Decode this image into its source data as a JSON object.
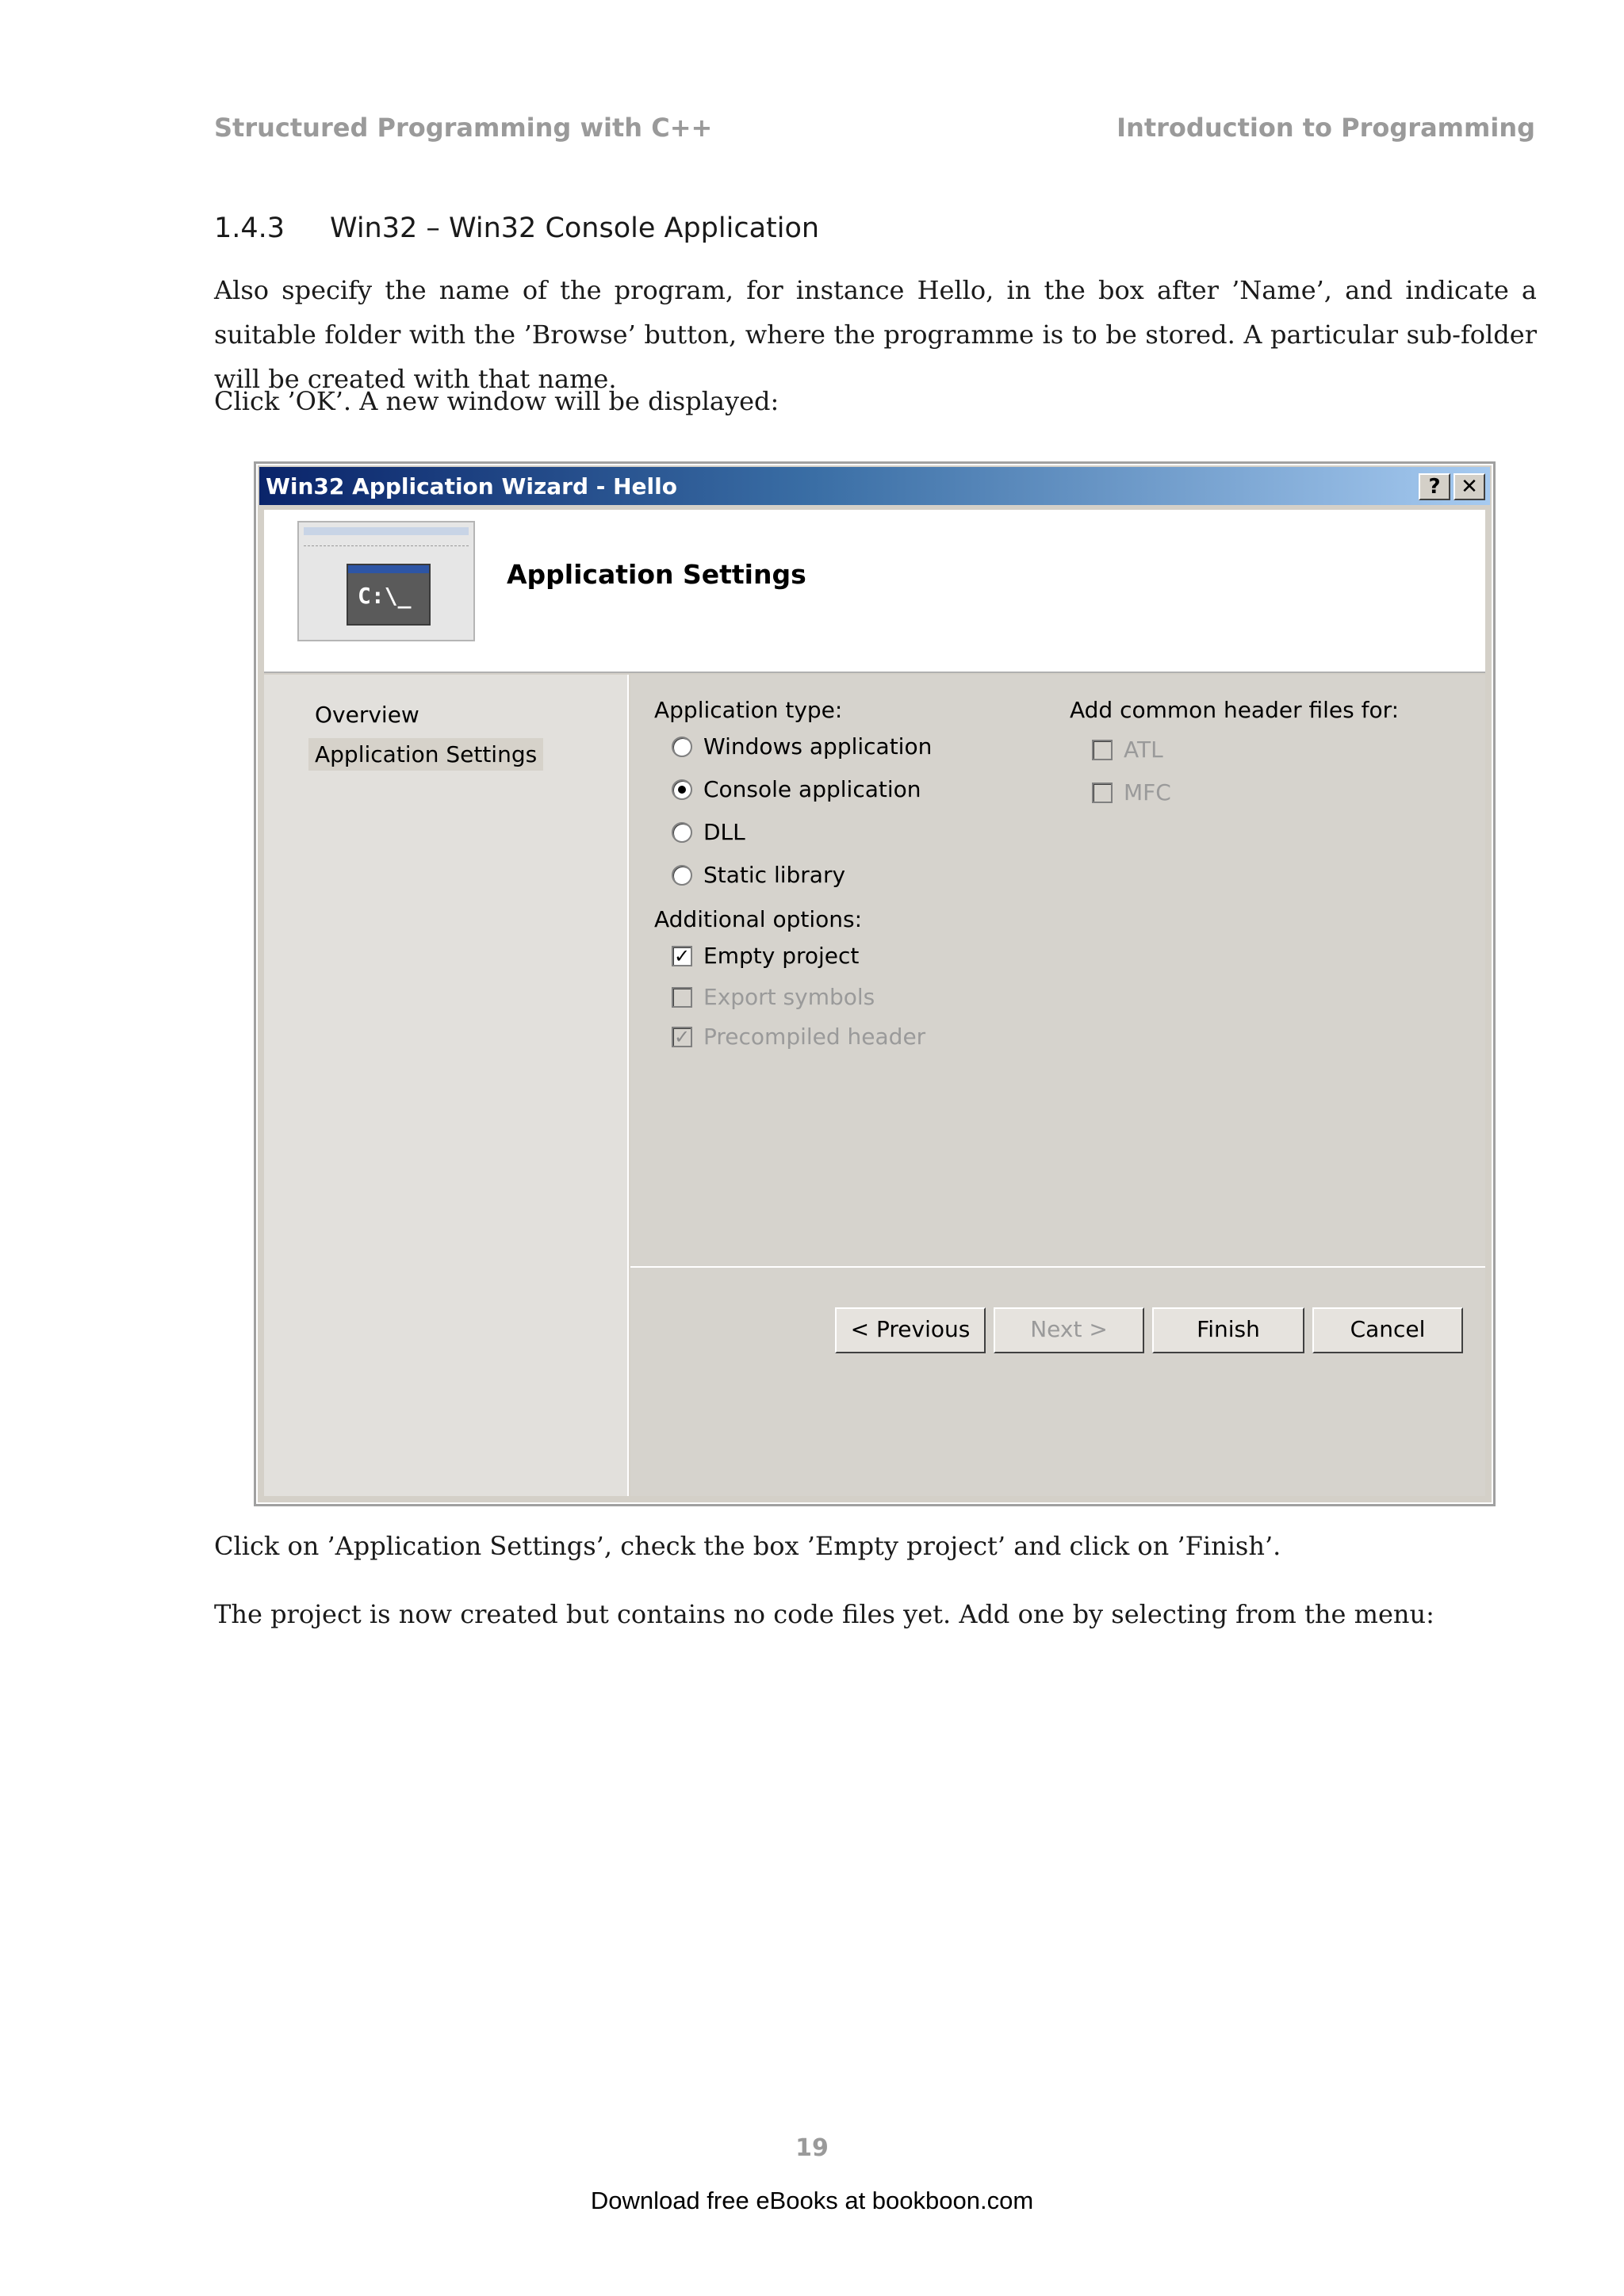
{
  "running_head": {
    "left": "Structured Programming with C++",
    "right": "Introduction to Programming"
  },
  "section": {
    "number": "1.4.3",
    "title": "Win32 – Win32 Console Application"
  },
  "paragraphs": {
    "p1": "Also specify the name of the program, for instance Hello, in the box after ’Name’, and indicate a suitable folder with the ’Browse’ button, where the programme is to be stored. A particular sub-folder will be created with that name.",
    "p2": "Click ’OK’. A new window will be displayed:",
    "p3": "Click on ’Application Settings’, check the box ’Empty project’ and click on ’Finish’.",
    "p4": "The project is now created but contains no code files yet. Add one by selecting from the menu:"
  },
  "dialog": {
    "title": "Win32 Application Wizard - Hello",
    "help_glyph": "?",
    "close_glyph": "✕",
    "header_title": "Application Settings",
    "console_prompt": "C:\\_",
    "nav": {
      "overview": "Overview",
      "application_settings": "Application Settings"
    },
    "application_type": {
      "label": "Application type:",
      "options": [
        {
          "label": "Windows application",
          "checked": false
        },
        {
          "label": "Console application",
          "checked": true
        },
        {
          "label": "DLL",
          "checked": false
        },
        {
          "label": "Static library",
          "checked": false
        }
      ]
    },
    "additional_options": {
      "label": "Additional options:",
      "options": [
        {
          "label": "Empty project",
          "checked": true,
          "enabled": true
        },
        {
          "label": "Export symbols",
          "checked": false,
          "enabled": false
        },
        {
          "label": "Precompiled header",
          "checked": true,
          "enabled": false
        }
      ]
    },
    "header_files": {
      "label": "Add common header files for:",
      "options": [
        {
          "label": "ATL",
          "checked": false,
          "enabled": false
        },
        {
          "label": "MFC",
          "checked": false,
          "enabled": false
        }
      ]
    },
    "buttons": {
      "previous": "< Previous",
      "next": "Next >",
      "finish": "Finish",
      "cancel": "Cancel"
    }
  },
  "page_number": "19",
  "footer": "Download free eBooks at bookboon.com"
}
